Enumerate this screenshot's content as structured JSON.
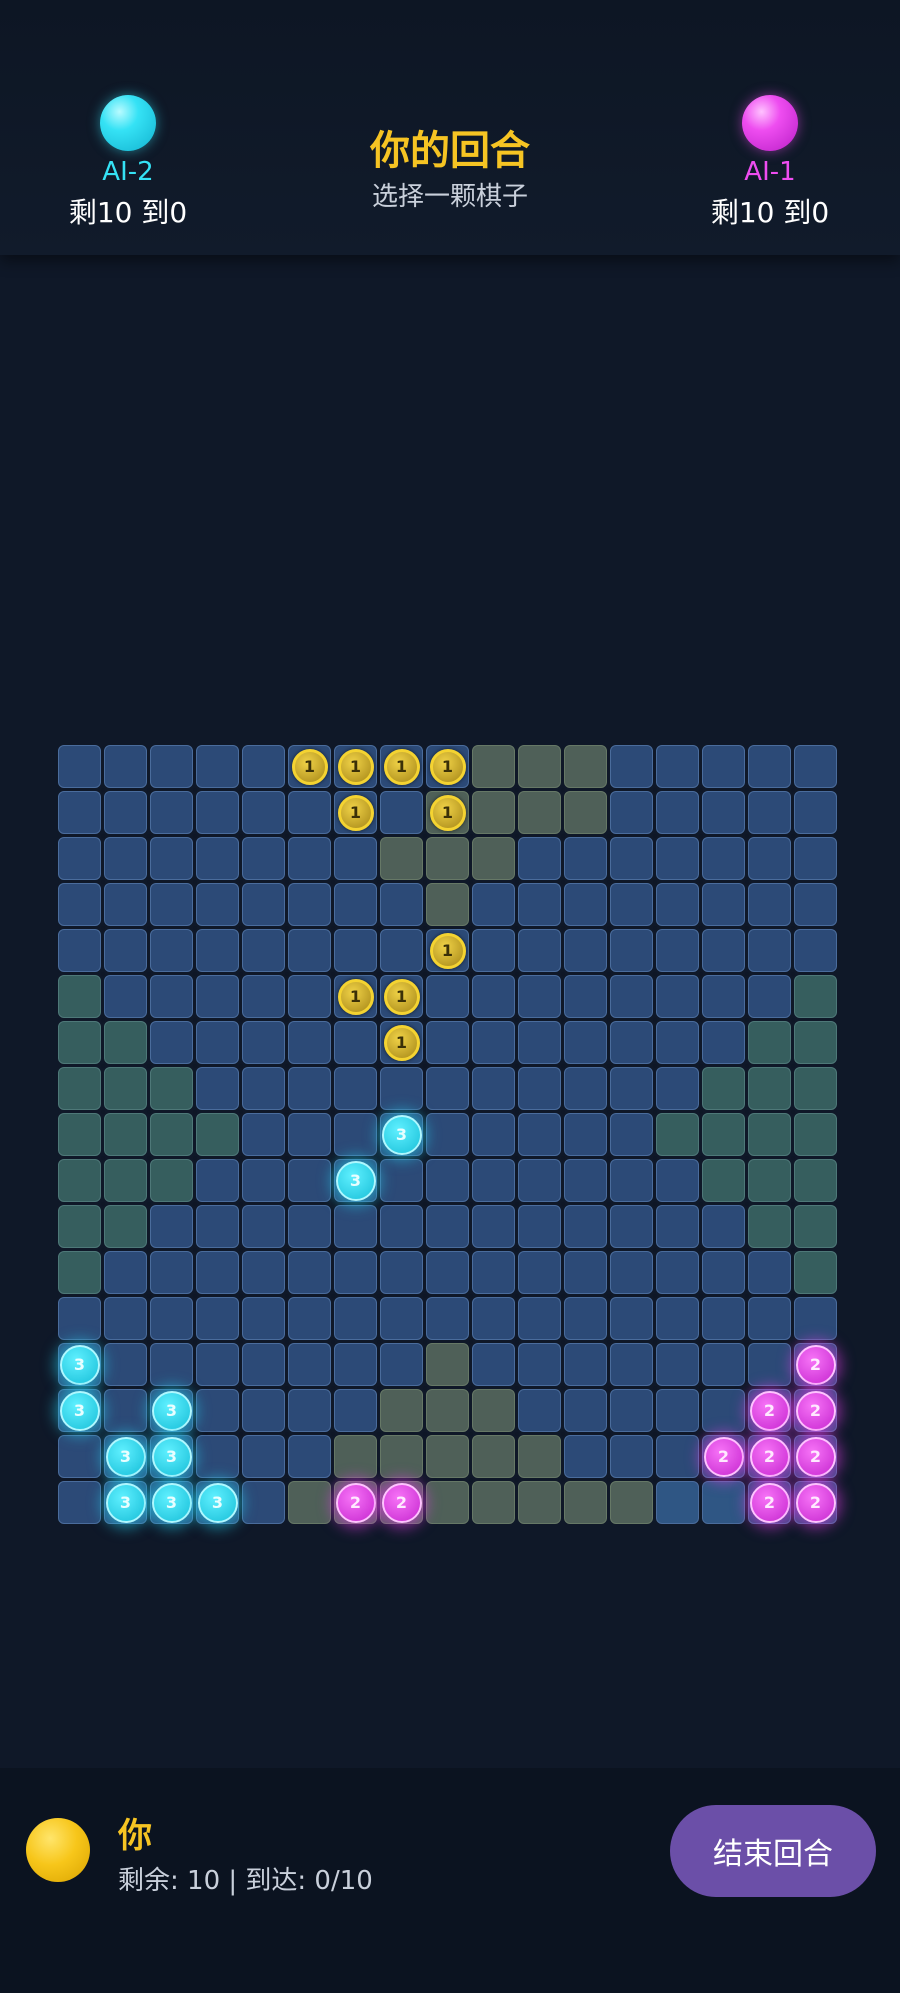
{
  "players": {
    "left": {
      "name": "AI-2",
      "stats": "剩10 到0",
      "color": "#35e2f5"
    },
    "right": {
      "name": "AI-1",
      "stats": "剩10 到0",
      "color": "#ee4df0"
    }
  },
  "turn": {
    "title": "你的回合",
    "subtitle": "选择一颗棋子"
  },
  "board": {
    "rows": 17,
    "cols": 17,
    "goal_zones": {
      "yellow": [
        [
          0,
          9
        ],
        [
          0,
          10
        ],
        [
          0,
          11
        ],
        [
          1,
          8
        ],
        [
          1,
          9
        ],
        [
          1,
          10
        ],
        [
          1,
          11
        ],
        [
          2,
          7
        ],
        [
          2,
          8
        ],
        [
          2,
          9
        ],
        [
          3,
          8
        ],
        [
          13,
          8
        ],
        [
          14,
          7
        ],
        [
          14,
          8
        ],
        [
          14,
          9
        ],
        [
          15,
          6
        ],
        [
          15,
          7
        ],
        [
          15,
          8
        ],
        [
          15,
          9
        ],
        [
          15,
          10
        ],
        [
          16,
          5
        ],
        [
          16,
          6
        ],
        [
          16,
          7
        ],
        [
          16,
          8
        ],
        [
          16,
          9
        ],
        [
          16,
          10
        ],
        [
          16,
          11
        ],
        [
          16,
          12
        ]
      ],
      "green": [
        [
          5,
          0
        ],
        [
          6,
          0
        ],
        [
          6,
          1
        ],
        [
          7,
          0
        ],
        [
          7,
          1
        ],
        [
          7,
          2
        ],
        [
          8,
          0
        ],
        [
          8,
          1
        ],
        [
          8,
          2
        ],
        [
          8,
          3
        ],
        [
          9,
          0
        ],
        [
          9,
          1
        ],
        [
          9,
          2
        ],
        [
          10,
          0
        ],
        [
          10,
          1
        ],
        [
          11,
          0
        ],
        [
          5,
          16
        ],
        [
          6,
          15
        ],
        [
          6,
          16
        ],
        [
          7,
          14
        ],
        [
          7,
          15
        ],
        [
          7,
          16
        ],
        [
          8,
          13
        ],
        [
          8,
          14
        ],
        [
          8,
          15
        ],
        [
          8,
          16
        ],
        [
          9,
          14
        ],
        [
          9,
          15
        ],
        [
          9,
          16
        ],
        [
          10,
          15
        ],
        [
          10,
          16
        ],
        [
          11,
          16
        ]
      ]
    },
    "highlight_cells": [
      [
        16,
        13
      ],
      [
        16,
        14
      ]
    ],
    "pieces": [
      {
        "player": "you",
        "label": "1",
        "r": 0,
        "c": 5
      },
      {
        "player": "you",
        "label": "1",
        "r": 0,
        "c": 6
      },
      {
        "player": "you",
        "label": "1",
        "r": 0,
        "c": 7
      },
      {
        "player": "you",
        "label": "1",
        "r": 0,
        "c": 8
      },
      {
        "player": "you",
        "label": "1",
        "r": 1,
        "c": 6
      },
      {
        "player": "you",
        "label": "1",
        "r": 1,
        "c": 8
      },
      {
        "player": "you",
        "label": "1",
        "r": 4,
        "c": 8
      },
      {
        "player": "you",
        "label": "1",
        "r": 5,
        "c": 6
      },
      {
        "player": "you",
        "label": "1",
        "r": 5,
        "c": 7
      },
      {
        "player": "you",
        "label": "1",
        "r": 6,
        "c": 7
      },
      {
        "player": "ai2",
        "label": "3",
        "r": 8,
        "c": 7
      },
      {
        "player": "ai2",
        "label": "3",
        "r": 9,
        "c": 6
      },
      {
        "player": "ai2",
        "label": "3",
        "r": 13,
        "c": 0
      },
      {
        "player": "ai2",
        "label": "3",
        "r": 14,
        "c": 0
      },
      {
        "player": "ai2",
        "label": "3",
        "r": 14,
        "c": 2
      },
      {
        "player": "ai2",
        "label": "3",
        "r": 15,
        "c": 1
      },
      {
        "player": "ai2",
        "label": "3",
        "r": 15,
        "c": 2
      },
      {
        "player": "ai2",
        "label": "3",
        "r": 16,
        "c": 1
      },
      {
        "player": "ai2",
        "label": "3",
        "r": 16,
        "c": 2
      },
      {
        "player": "ai2",
        "label": "3",
        "r": 16,
        "c": 3
      },
      {
        "player": "ai1",
        "label": "2",
        "r": 13,
        "c": 16
      },
      {
        "player": "ai1",
        "label": "2",
        "r": 14,
        "c": 15
      },
      {
        "player": "ai1",
        "label": "2",
        "r": 14,
        "c": 16
      },
      {
        "player": "ai1",
        "label": "2",
        "r": 15,
        "c": 14
      },
      {
        "player": "ai1",
        "label": "2",
        "r": 15,
        "c": 15
      },
      {
        "player": "ai1",
        "label": "2",
        "r": 15,
        "c": 16
      },
      {
        "player": "ai1",
        "label": "2",
        "r": 16,
        "c": 15
      },
      {
        "player": "ai1",
        "label": "2",
        "r": 16,
        "c": 16
      },
      {
        "player": "ai1",
        "label": "2",
        "r": 16,
        "c": 6
      },
      {
        "player": "ai1",
        "label": "2",
        "r": 16,
        "c": 7
      }
    ]
  },
  "footer": {
    "name": "你",
    "stats": "剩余: 10 | 到达: 0/10",
    "end_turn_label": "结束回合",
    "accent": "#6b4fa8"
  }
}
